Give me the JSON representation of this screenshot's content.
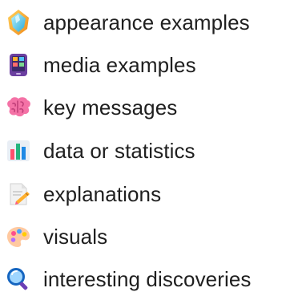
{
  "items": [
    {
      "icon": "crystal-gem-icon",
      "label": "appearance examples"
    },
    {
      "icon": "tablet-device-icon",
      "label": "media examples"
    },
    {
      "icon": "brain-icon",
      "label": "key messages"
    },
    {
      "icon": "bar-chart-icon",
      "label": "data or statistics"
    },
    {
      "icon": "pencil-paper-icon",
      "label": "explanations"
    },
    {
      "icon": "paint-palette-icon",
      "label": "visuals"
    },
    {
      "icon": "magnifying-glass-icon",
      "label": "interesting discoveries"
    }
  ]
}
